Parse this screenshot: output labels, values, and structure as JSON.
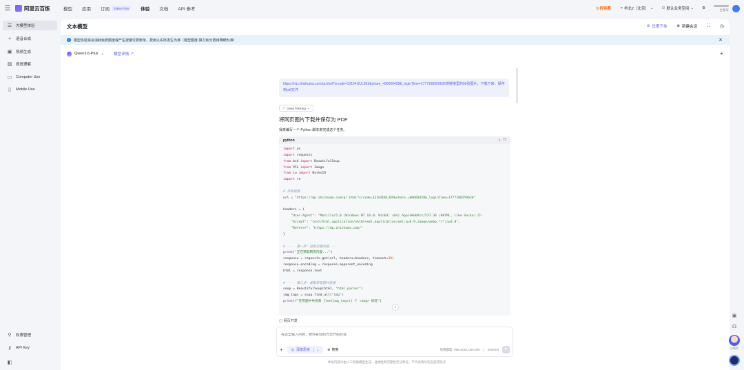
{
  "brand": {
    "name": "阿里云百炼"
  },
  "topnav": {
    "items": [
      {
        "label": "模型",
        "active": false
      },
      {
        "label": "应用",
        "active": false
      },
      {
        "label": "订阅",
        "active": false,
        "tag": "Token Plan"
      },
      {
        "label": "体验",
        "active": true
      },
      {
        "label": "文档",
        "active": false
      },
      {
        "label": "API 参考",
        "active": false
      }
    ],
    "promo": "5 折特惠",
    "region": "华北2（北京）",
    "workspace": "默认业务空间",
    "user_sub": "主账号"
  },
  "sidebar": {
    "items": [
      {
        "label": "大模型体验",
        "icon": "text-icon",
        "active": true
      },
      {
        "label": "语音合成",
        "icon": "plus-icon",
        "active": false
      },
      {
        "label": "视频生成",
        "icon": "video-icon",
        "active": false
      },
      {
        "label": "视觉理解",
        "icon": "image-icon",
        "active": false
      },
      {
        "label": "Computer Use",
        "icon": "monitor-icon",
        "active": false
      },
      {
        "label": "Mobile Use",
        "icon": "mobile-icon",
        "active": false
      }
    ],
    "bottom": [
      {
        "label": "权限管理",
        "icon": "user-icon"
      },
      {
        "label": "API Key",
        "icon": "key-icon"
      }
    ]
  },
  "main": {
    "title": "文本模型",
    "actions": {
      "optimize": "优惠下单",
      "new_chat": "新建会话"
    },
    "notice": "模型体验将会消耗免费额度或产生按量付费账单，费用以实际发生为准（模型额度-算力积分费用明细为准）",
    "model": {
      "name": "Qwen3.6-Plus",
      "detail_link": "模型详情"
    }
  },
  "chat": {
    "user_message": "https://mp.zhizhuma.com/qr.html?crcode=12164UUL3E9&share_=80660428&_loginTime=1777188359636将链接里的56张图片，下载下来，保存到pdf文件",
    "thinking_label": "Deep thinking",
    "heading": "将网页图片下载并保存为 PDF",
    "intro": "我来编写一个 Python 脚本来完成这个任务。",
    "code_lang": "python",
    "web_dev_label": "网页开发"
  },
  "input": {
    "placeholder": "在这里输入内容，按你喜欢的方式开始对话",
    "think_label": "深度思考",
    "search_label": "搜索",
    "quota_text": "免费额度: 996,422/1,000,000",
    "char_count": "0/32000"
  },
  "footer": {
    "note": "体验内容均由人工智能模型生成，准确性和完整性无法保证，不代表我们的态度或观点"
  },
  "float": {
    "robot_label": "小助手"
  }
}
